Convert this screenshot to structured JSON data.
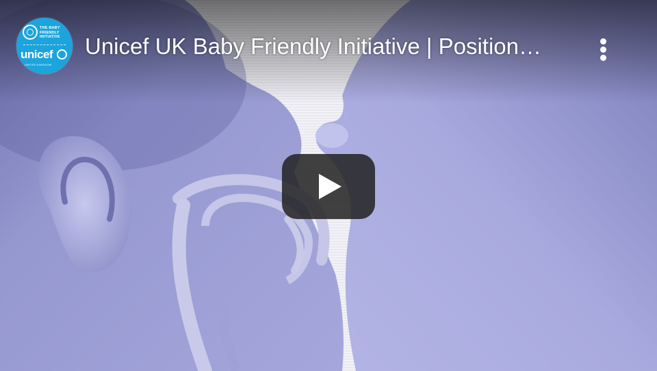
{
  "video": {
    "title": "Unicef UK Baby Friendly Initiative | Position…"
  },
  "channel": {
    "avatar_tagline": "THE BABY FRIENDLY INITIATIVE",
    "avatar_brand": "unicef",
    "avatar_subtitle": "UNITED KINGDOM"
  },
  "controls": {
    "play_icon": "play-icon",
    "more_icon": "more-vertical-icon"
  },
  "colors": {
    "play_button_bg": "#212121",
    "avatar_bg": "#1ca4dc",
    "thumbnail_tint": "#a9aad6"
  }
}
